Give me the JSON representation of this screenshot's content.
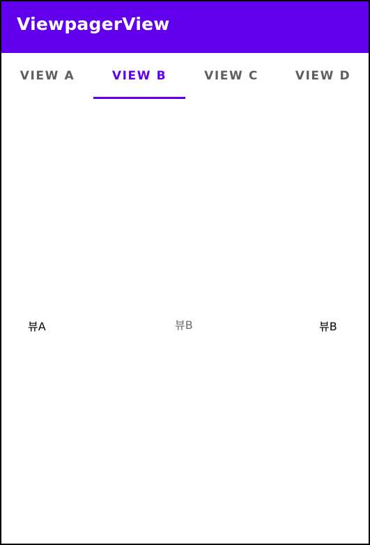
{
  "app_bar": {
    "title": "ViewpagerView",
    "color": "#6200ee"
  },
  "tabs": {
    "selected_index": 1,
    "items": [
      {
        "label": "VIEW A"
      },
      {
        "label": "VIEW B"
      },
      {
        "label": "VIEW C"
      },
      {
        "label": "VIEW D"
      }
    ],
    "selected_color": "#6200ee",
    "unselected_color": "#5f5f5f"
  },
  "pager": {
    "pages": [
      {
        "text": "뷰A"
      },
      {
        "text": "뷰B"
      },
      {
        "text": "뷰B"
      }
    ]
  }
}
